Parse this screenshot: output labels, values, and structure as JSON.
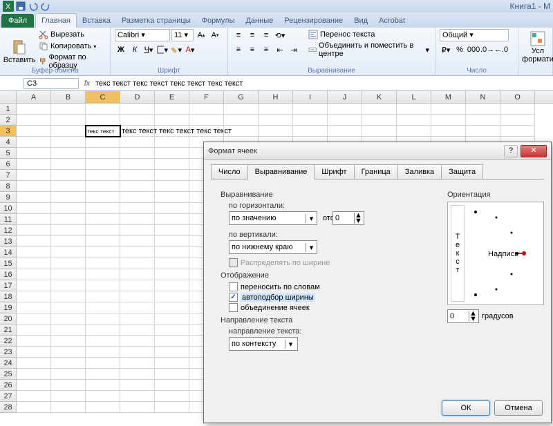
{
  "app": {
    "title": "Книга1 - M"
  },
  "qat": [
    "excel",
    "save",
    "undo",
    "redo"
  ],
  "tabs": {
    "file": "Файл",
    "items": [
      "Главная",
      "Вставка",
      "Разметка страницы",
      "Формулы",
      "Данные",
      "Рецензирование",
      "Вид",
      "Acrobat"
    ],
    "active": 0
  },
  "ribbon": {
    "clipboard": {
      "label": "Буфер обмена",
      "paste": "Вставить",
      "cut": "Вырезать",
      "copy": "Копировать",
      "format_painter": "Формат по образцу"
    },
    "font": {
      "label": "Шрифт",
      "name": "Calibri",
      "size": "11"
    },
    "alignment": {
      "label": "Выравнивание",
      "wrap": "Перенос текста",
      "merge": "Объединить и поместить в центре"
    },
    "number": {
      "label": "Число",
      "format": "Общий"
    },
    "styles": {
      "cond": "Усл",
      "format": "формати"
    }
  },
  "formula_bar": {
    "name_box": "C3",
    "fx": "fx",
    "formula": "текс текст текс текст текс текст текс текст"
  },
  "grid": {
    "columns": [
      "A",
      "B",
      "C",
      "D",
      "E",
      "F",
      "G",
      "H",
      "I",
      "J",
      "K",
      "L",
      "M",
      "N",
      "O"
    ],
    "active_col": "C",
    "active_row": 3,
    "row_count": 28,
    "c3_display": "текс текст",
    "overflow_text": "текс текст текс текст текс текст"
  },
  "dialog": {
    "title": "Формат ячеек",
    "tabs": [
      "Число",
      "Выравнивание",
      "Шрифт",
      "Граница",
      "Заливка",
      "Защита"
    ],
    "active_tab": 1,
    "alignment": {
      "section": "Выравнивание",
      "horizontal_label": "по горизонтали:",
      "horizontal_value": "по значению",
      "indent_label": "отступ:",
      "indent_value": "0",
      "vertical_label": "по вертикали:",
      "vertical_value": "по нижнему краю",
      "distribute": "Распределять по ширине"
    },
    "display": {
      "section": "Отображение",
      "wrap": "переносить по словам",
      "autofit": "автоподбор ширины",
      "autofit_checked": true,
      "merge": "объединение ячеек"
    },
    "direction": {
      "section": "Направление текста",
      "label": "направление текста:",
      "value": "по контексту"
    },
    "orientation": {
      "section": "Ориентация",
      "vtext": "Текст",
      "htext": "Надпись",
      "degrees_value": "0",
      "degrees_label": "градусов"
    },
    "buttons": {
      "ok": "ОК",
      "cancel": "Отмена"
    }
  }
}
